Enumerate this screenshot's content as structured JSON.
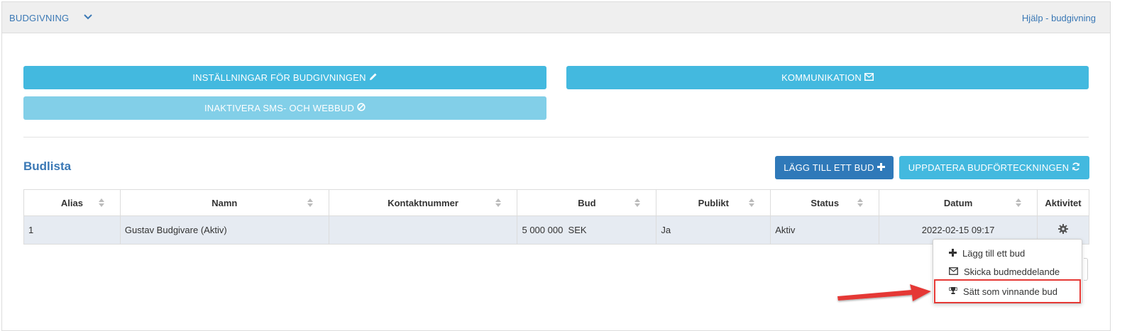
{
  "topbar": {
    "title": "BUDGIVNING",
    "help_link": "Hjälp - budgivning"
  },
  "actions": {
    "settings_label": "INSTÄLLNINGAR FÖR BUDGIVNINGEN",
    "communication_label": "KOMMUNIKATION",
    "deactivate_label": "INAKTIVERA SMS- OCH WEBBUD"
  },
  "bidlist": {
    "title": "Budlista",
    "add_bid_label": "LÄGG TILL ETT BUD",
    "update_label": "UPPDATERA BUDFÖRTECKNINGEN",
    "columns": [
      "Alias",
      "Namn",
      "Kontaktnummer",
      "Bud",
      "Publikt",
      "Status",
      "Datum",
      "Aktivitet"
    ],
    "rows": [
      {
        "alias": "1",
        "name": "Gustav Budgivare (Aktiv)",
        "contact": "",
        "bid": "5 000 000  SEK",
        "public": "Ja",
        "status": "Aktiv",
        "date": "2022-02-15 09:17"
      }
    ]
  },
  "dropdown": {
    "items": [
      "Lägg till ett bud",
      "Skicka budmeddelande",
      "Sätt som vinnande bud"
    ]
  },
  "colors": {
    "accent": "#43b9df",
    "primary": "#2f79b9",
    "link": "#3a78b5",
    "annotation": "#e53935"
  }
}
